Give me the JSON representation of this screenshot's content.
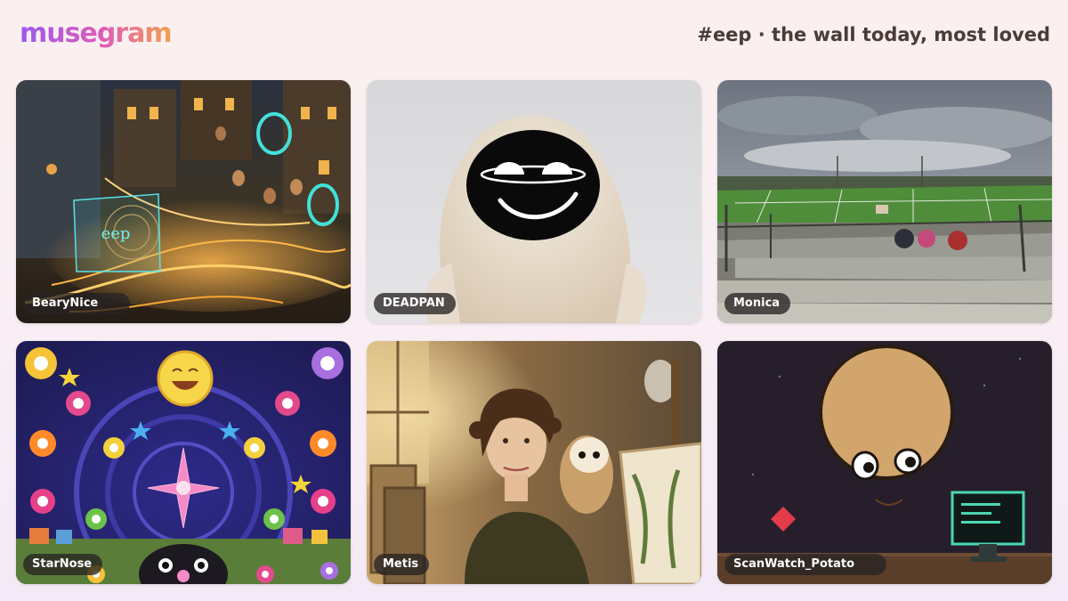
{
  "header": {
    "logo": "musegram",
    "tagline": "#eep · the wall today, most loved"
  },
  "cards": [
    {
      "handle": "BearyNice",
      "art_text": "eep"
    },
    {
      "handle": "DEADPAN"
    },
    {
      "handle": "Monica"
    },
    {
      "handle": "StarNose"
    },
    {
      "handle": "Metis"
    },
    {
      "handle": "ScanWatch_Potato"
    }
  ],
  "colors": {
    "logo_gradient": [
      "#9b59f0",
      "#e05cb8",
      "#f3a04a"
    ],
    "tagline": "#4a3b35",
    "handle_bg": "#282422"
  }
}
